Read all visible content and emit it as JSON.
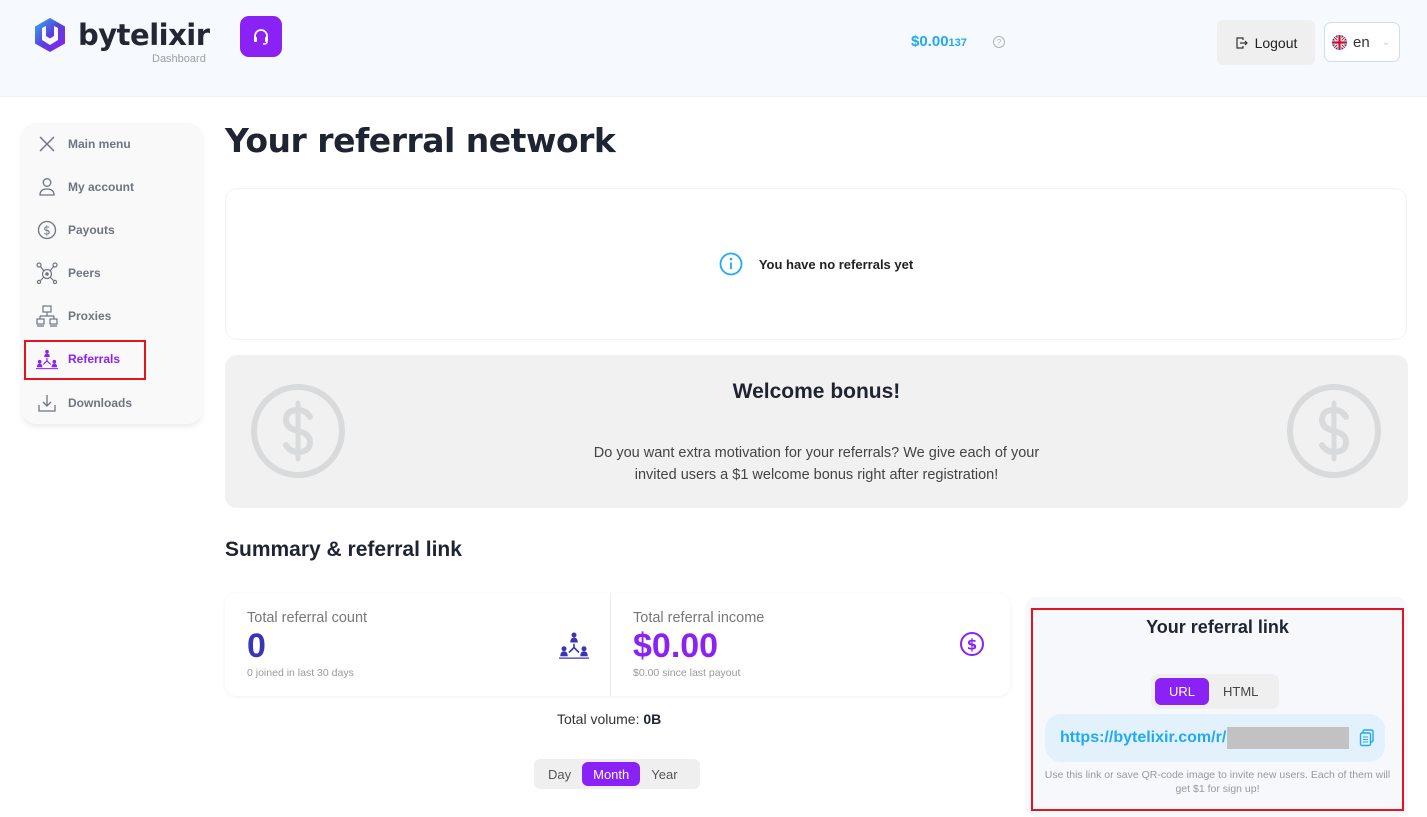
{
  "header": {
    "brand": "bytelixir",
    "brand_sub": "Dashboard",
    "balance_main": "$0.00",
    "balance_fraction": "137",
    "logout_label": "Logout",
    "language": "en",
    "accent_color": "#8a22f5",
    "balance_color": "#22aaf0"
  },
  "sidebar": {
    "items": [
      {
        "label": "Main menu",
        "icon": "close-icon"
      },
      {
        "label": "My account",
        "icon": "user-icon"
      },
      {
        "label": "Payouts",
        "icon": "dollar-circle-icon"
      },
      {
        "label": "Peers",
        "icon": "peers-network-icon"
      },
      {
        "label": "Proxies",
        "icon": "proxies-network-icon"
      },
      {
        "label": "Referrals",
        "icon": "referrals-icon",
        "active": true
      },
      {
        "label": "Downloads",
        "icon": "download-icon"
      }
    ]
  },
  "main": {
    "title": "Your referral network",
    "empty_message": "You have no referrals yet",
    "bonus": {
      "title": "Welcome bonus!",
      "line1": "Do you want extra motivation for your referrals? We give each of your",
      "line2": "invited users a $1 welcome bonus right after registration!"
    },
    "summary_title": "Summary & referral link",
    "stats": [
      {
        "label": "Total referral count",
        "value": "0",
        "sub": "0 joined in last 30 days",
        "icon": "referrals-icon",
        "color": "#3b35b5"
      },
      {
        "label": "Total referral income",
        "value": "$0.00",
        "sub": "$0.00 since last payout",
        "icon": "dollar-circle-icon",
        "color": "#8a22f5"
      }
    ],
    "total_volume_label": "Total volume:",
    "total_volume_value": "0B",
    "periods": [
      {
        "label": "Day"
      },
      {
        "label": "Month",
        "active": true
      },
      {
        "label": "Year"
      }
    ]
  },
  "referral_link": {
    "title": "Your referral link",
    "formats": [
      {
        "label": "URL",
        "active": true
      },
      {
        "label": "HTML"
      }
    ],
    "url_prefix": "https://bytelixir.com/r/",
    "hint": "Use this link or save QR-code image to invite new users. Each of them will get $1 for sign up!"
  }
}
